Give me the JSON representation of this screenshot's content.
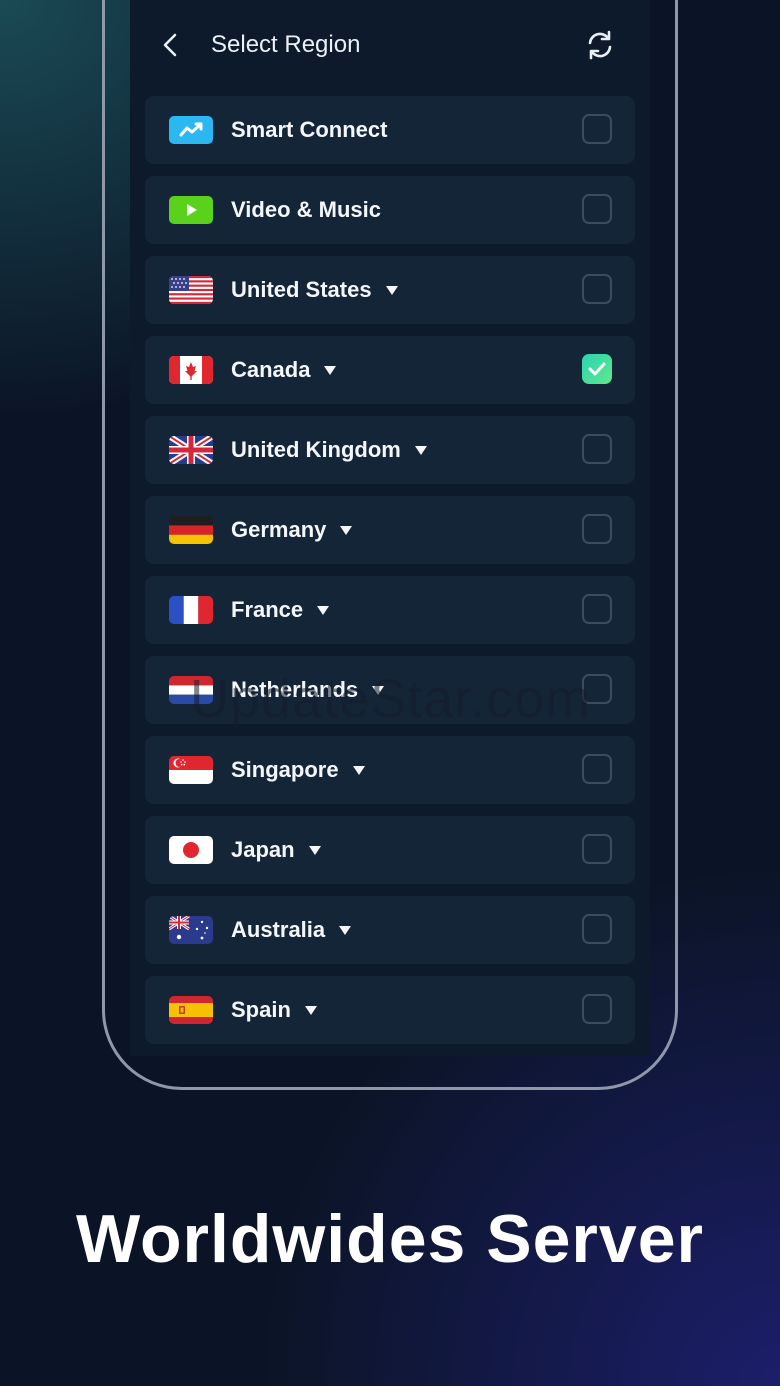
{
  "header": {
    "title": "Select Region"
  },
  "regions": [
    {
      "name": "Smart Connect",
      "icon": "smart-connect-icon",
      "expandable": false,
      "selected": false
    },
    {
      "name": "Video & Music",
      "icon": "play-icon",
      "expandable": false,
      "selected": false
    },
    {
      "name": "United States",
      "icon": "us-flag-icon",
      "expandable": true,
      "selected": false
    },
    {
      "name": "Canada",
      "icon": "canada-flag-icon",
      "expandable": true,
      "selected": true
    },
    {
      "name": "United Kingdom",
      "icon": "uk-flag-icon",
      "expandable": true,
      "selected": false
    },
    {
      "name": "Germany",
      "icon": "germany-flag-icon",
      "expandable": true,
      "selected": false
    },
    {
      "name": "France",
      "icon": "france-flag-icon",
      "expandable": true,
      "selected": false
    },
    {
      "name": "Netherlands",
      "icon": "netherlands-flag-icon",
      "expandable": true,
      "selected": false
    },
    {
      "name": "Singapore",
      "icon": "singapore-flag-icon",
      "expandable": true,
      "selected": false
    },
    {
      "name": "Japan",
      "icon": "japan-flag-icon",
      "expandable": true,
      "selected": false
    },
    {
      "name": "Australia",
      "icon": "australia-flag-icon",
      "expandable": true,
      "selected": false
    },
    {
      "name": "Spain",
      "icon": "spain-flag-icon",
      "expandable": true,
      "selected": false
    }
  ],
  "watermark": "UpdateStar.com",
  "caption": "Worldwides Server",
  "colors": {
    "accent": "#3ee0a0",
    "row_bg": "#152538",
    "screen_bg": "#0d1a2c"
  }
}
